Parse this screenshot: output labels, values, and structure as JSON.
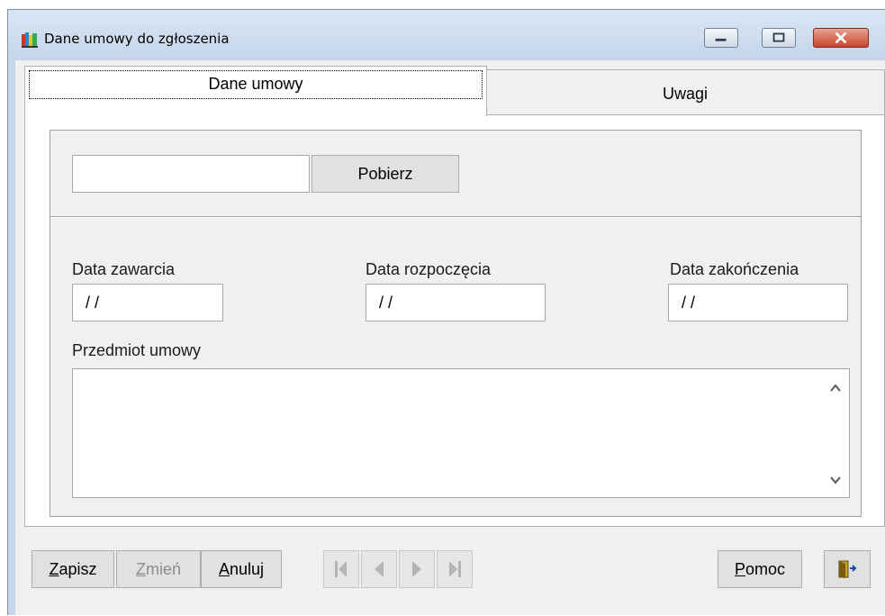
{
  "window": {
    "title": "Dane umowy do zgłoszenia",
    "icon": "books-icon"
  },
  "tabs": [
    {
      "label": "Dane umowy",
      "active": true
    },
    {
      "label": "Uwagi",
      "active": false
    }
  ],
  "fetch": {
    "input_value": "",
    "button_label": "Pobierz"
  },
  "dates": {
    "zawarcia": {
      "label": "Data zawarcia",
      "value": "/ /"
    },
    "rozpoczecia": {
      "label": "Data rozpoczęcia",
      "value": "/ /"
    },
    "zakonczenia": {
      "label": "Data zakończenia",
      "value": "/ /"
    }
  },
  "subject": {
    "label": "Przedmiot umowy",
    "value": ""
  },
  "toolbar": {
    "save": {
      "first": "Z",
      "rest": "apisz"
    },
    "edit": {
      "first": "Z",
      "rest": "mień",
      "enabled": false
    },
    "cancel": {
      "first": "A",
      "rest": "nuluj"
    },
    "help": {
      "first": "P",
      "rest": "omoc"
    },
    "exit_icon": "exit-door-icon"
  },
  "colors": {
    "window_frame": "#c6d6e8",
    "client_bg": "#f0f0f0",
    "close_button": "#c8452f"
  }
}
